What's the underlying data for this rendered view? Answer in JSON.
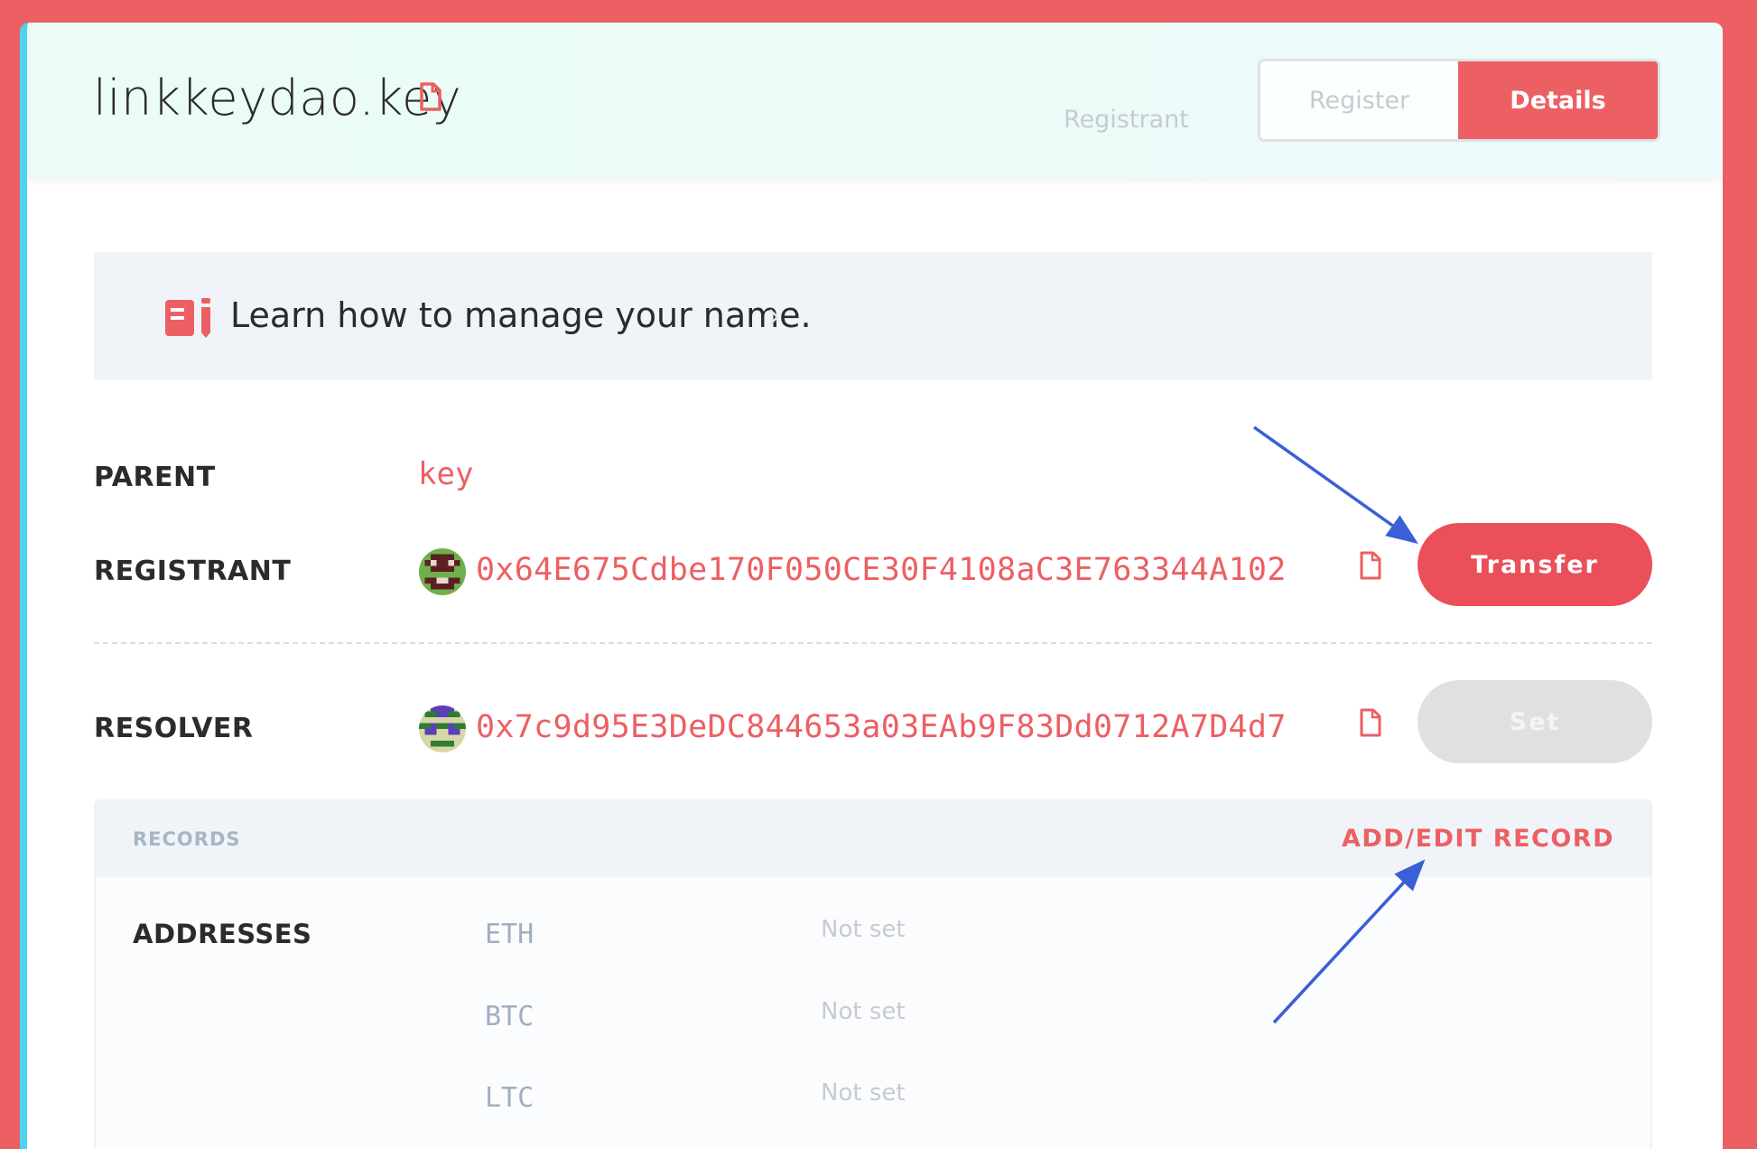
{
  "header": {
    "domain": "linkkeydao.key",
    "nav_registrant": "Registrant",
    "tabs": [
      {
        "label": "Register",
        "active": false
      },
      {
        "label": "Details",
        "active": true
      }
    ]
  },
  "banner": {
    "text": "Learn how to manage your name.",
    "icon": "book-icon"
  },
  "details": {
    "parent": {
      "label": "PARENT",
      "value": "key"
    },
    "registrant": {
      "label": "REGISTRANT",
      "address": "0x64E675Cdbe170F050CE30F4108aC3E763344A102",
      "button": "Transfer"
    },
    "resolver": {
      "label": "RESOLVER",
      "address": "0x7c9d95E3DeDC844653a03EAb9F83Dd0712A7D4d7",
      "button": "Set"
    }
  },
  "records": {
    "title": "RECORDS",
    "action": "ADD/EDIT RECORD",
    "addresses_label": "ADDRESSES",
    "coins": [
      {
        "symbol": "ETH",
        "value": "Not set"
      },
      {
        "symbol": "BTC",
        "value": "Not set"
      },
      {
        "symbol": "LTC",
        "value": "Not set"
      }
    ]
  },
  "colors": {
    "accent": "#ec5f63",
    "transfer_button": "#ea4f5a",
    "annotation_arrow": "#3a5fd6",
    "sidebar_stripe": "#4cd3ef"
  }
}
